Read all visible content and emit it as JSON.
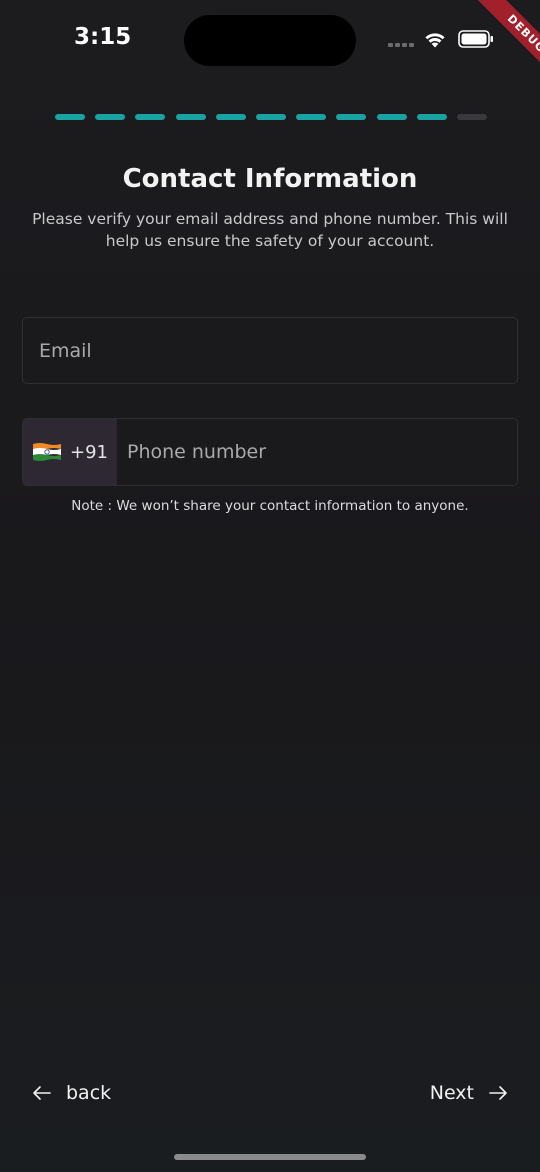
{
  "status_bar": {
    "time": "3:15",
    "debug_label": "DEBUG"
  },
  "progress": {
    "total_steps": 11,
    "completed_steps": 10,
    "active_color": "#1aa3a3",
    "inactive_color": "#3a3a3e"
  },
  "header": {
    "title": "Contact Information",
    "subtitle": "Please verify your email address and phone number. This will help us ensure the safety of your account."
  },
  "form": {
    "email_placeholder": "Email",
    "email_value": "",
    "country_flag": "india-flag-icon",
    "dial_code": "+91",
    "phone_placeholder": "Phone number",
    "phone_value": ""
  },
  "note": "Note : We won’t share your contact information to anyone.",
  "navigation": {
    "back_label": "back",
    "next_label": "Next"
  },
  "colors": {
    "background": "#1a1a1d",
    "accent": "#1aa3a3",
    "picker_bg": "#2e2832"
  }
}
